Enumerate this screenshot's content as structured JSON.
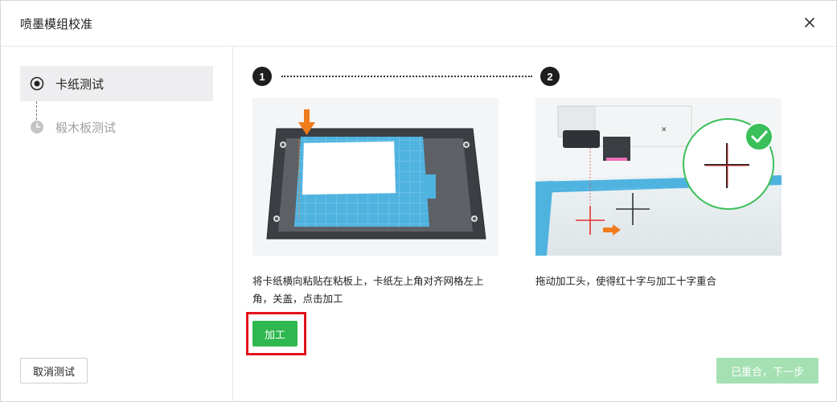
{
  "dialog": {
    "title": "喷墨模组校准",
    "close_icon": "close-icon"
  },
  "sidebar": {
    "steps": [
      {
        "label": "卡纸测试",
        "icon": "radio-selected-icon",
        "state": "active"
      },
      {
        "label": "椴木板测试",
        "icon": "clock-icon",
        "state": "pending"
      }
    ],
    "cancel_label": "取消测试"
  },
  "main": {
    "steps": [
      {
        "number": "1",
        "description": "将卡纸横向粘贴在粘板上，卡纸左上角对齐网格左上角，关盖，点击加工"
      },
      {
        "number": "2",
        "description": "拖动加工头，使得红十字与加工十字重合"
      }
    ],
    "process_label": "加工",
    "next_label": "已重合，下一步"
  },
  "colors": {
    "accent": "#2eb84f",
    "accent_disabled": "#a4e0b2",
    "highlight": "#e3141c",
    "arrow": "#f07c1e",
    "mat": "#4fb3e0"
  }
}
